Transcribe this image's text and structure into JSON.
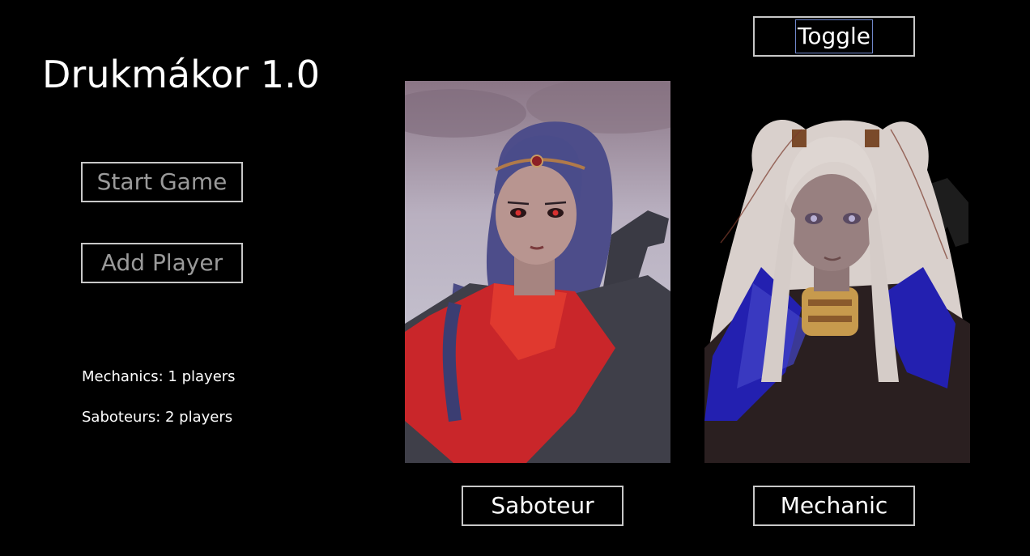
{
  "app": {
    "title": "Drukmákor 1.0"
  },
  "menu": {
    "start_label": "Start Game",
    "add_player_label": "Add Player"
  },
  "counts": {
    "mechanics": "Mechanics: 1 players",
    "saboteurs": "Saboteurs: 2 players"
  },
  "toggle": {
    "label": "Toggle"
  },
  "roles": [
    {
      "label": "Saboteur",
      "portrait_icon": "saboteur-portrait-icon"
    },
    {
      "label": "Mechanic",
      "portrait_icon": "mechanic-portrait-icon"
    }
  ],
  "colors": {
    "background": "#000000",
    "button_border": "#c8c8c8",
    "dim_text": "#9a9a9a",
    "bright_text": "#ffffff"
  }
}
